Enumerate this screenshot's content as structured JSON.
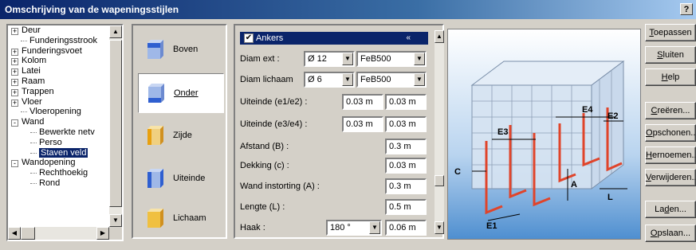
{
  "window": {
    "title": "Omschrijving van de wapeningsstijlen",
    "help_label": "?"
  },
  "tree": {
    "items": [
      {
        "label": "Deur",
        "level": 0,
        "expander": "+"
      },
      {
        "label": "Funderingsstrook",
        "level": 1,
        "expander": ""
      },
      {
        "label": "Funderingsvoet",
        "level": 0,
        "expander": "+"
      },
      {
        "label": "Kolom",
        "level": 0,
        "expander": "+"
      },
      {
        "label": "Latei",
        "level": 0,
        "expander": "+"
      },
      {
        "label": "Raam",
        "level": 0,
        "expander": "+"
      },
      {
        "label": "Trappen",
        "level": 0,
        "expander": "+"
      },
      {
        "label": "Vloer",
        "level": 0,
        "expander": "+"
      },
      {
        "label": "Vloeropening",
        "level": 1,
        "expander": ""
      },
      {
        "label": "Wand",
        "level": 0,
        "expander": "-"
      },
      {
        "label": "Bewerkte netv",
        "level": 2,
        "expander": ""
      },
      {
        "label": "Perso",
        "level": 2,
        "expander": ""
      },
      {
        "label": "Staven veld",
        "level": 2,
        "expander": "",
        "selected": true
      },
      {
        "label": "Wandopening",
        "level": 0,
        "expander": "-"
      },
      {
        "label": "Rechthoekig",
        "level": 2,
        "expander": ""
      },
      {
        "label": "Rond",
        "level": 2,
        "expander": ""
      }
    ]
  },
  "categories": [
    {
      "label": "Boven",
      "color": "#2f5fd0"
    },
    {
      "label": "Onder",
      "color": "#2f5fd0",
      "active": true
    },
    {
      "label": "Zijde",
      "color": "#e8b020"
    },
    {
      "label": "Uiteinde",
      "color": "#2f5fd0"
    },
    {
      "label": "Lichaam",
      "color": "#e8b020"
    }
  ],
  "panel": {
    "header": "Ankers",
    "header_checked": true,
    "collapse_glyph": "«",
    "fields": {
      "diam_ext": {
        "label": "Diam ext :",
        "diameter": "Ø 12",
        "steel": "FeB500"
      },
      "diam_body": {
        "label": "Diam lichaam",
        "diameter": "Ø 6",
        "steel": "FeB500"
      },
      "end_e1e2": {
        "label": "Uiteinde (e1/e2) :",
        "v1": "0.03 m",
        "v2": "0.03 m"
      },
      "end_e3e4": {
        "label": "Uiteinde (e3/e4) :",
        "v1": "0.03 m",
        "v2": "0.03 m"
      },
      "distance": {
        "label": "Afstand (B) :",
        "value": "0.3 m"
      },
      "cover": {
        "label": "Dekking (c) :",
        "value": "0.03 m"
      },
      "wall_insert": {
        "label": "Wand instorting (A) :",
        "value": "0.3 m"
      },
      "length": {
        "label": "Lengte (L) :",
        "value": "0.5 m"
      },
      "hook": {
        "label": "Haak :",
        "angle": "180 °",
        "value": "0.06 m"
      }
    }
  },
  "diagram": {
    "labels": [
      "E4",
      "E3",
      "E2",
      "C",
      "A",
      "L",
      "E1"
    ]
  },
  "buttons": [
    {
      "key": "apply",
      "label_u": "T",
      "label_rest": "oepassen"
    },
    {
      "key": "close",
      "label_u": "S",
      "label_rest": "luiten"
    },
    {
      "key": "help",
      "label_u": "H",
      "label_rest": "elp"
    },
    {
      "key": "create",
      "label_u": "C",
      "label_rest": "reëren..."
    },
    {
      "key": "cleanup",
      "label_u": "O",
      "label_rest": "pschonen..."
    },
    {
      "key": "rename",
      "label_u": "H",
      "label_rest": "ernoemen..."
    },
    {
      "key": "delete",
      "label_u": "V",
      "label_rest": "erwijderen..."
    },
    {
      "key": "load",
      "label_pre": "La",
      "label_u": "d",
      "label_rest": "en..."
    },
    {
      "key": "save",
      "label_u": "O",
      "label_rest": "pslaan..."
    }
  ]
}
